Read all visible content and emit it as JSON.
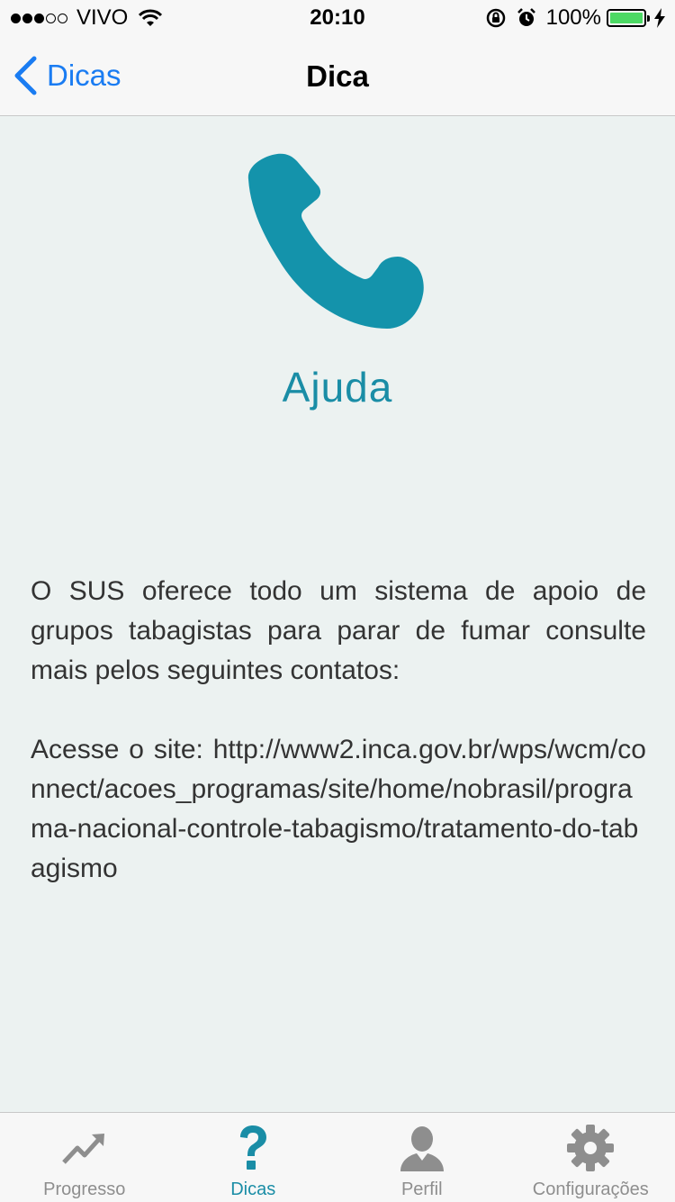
{
  "status_bar": {
    "carrier": "VIVO",
    "time": "20:10",
    "battery": "100%",
    "signal_bars_filled": 3,
    "signal_bars_total": 5,
    "icons": [
      "wifi-icon",
      "rotation-lock-icon",
      "alarm-icon",
      "battery-icon",
      "charging-icon"
    ]
  },
  "nav": {
    "back_label": "Dicas",
    "title": "Dica"
  },
  "tip": {
    "icon": "phone-icon",
    "title": "Ajuda",
    "paragraph1": "O SUS oferece todo um sistema de apoio de grupos tabagistas para parar de fumar consulte mais pelos seguintes contatos:",
    "paragraph2": "Acesse o site: http://www2.inca.gov.br/wps/wcm/connect/acoes_programas/site/home/nobrasil/programa-nacional-controle-tabagismo/tratamento-do-tabagismo"
  },
  "tabs": [
    {
      "label": "Progresso",
      "icon": "trend-chart-icon",
      "active": false
    },
    {
      "label": "Dicas",
      "icon": "question-mark-icon",
      "active": true
    },
    {
      "label": "Perfil",
      "icon": "person-icon",
      "active": false
    },
    {
      "label": "Configurações",
      "icon": "gear-icon",
      "active": false
    }
  ],
  "colors": {
    "accent": "#1a8da6",
    "ios_blue": "#1a7cf2",
    "background": "#ecf2f1",
    "inactive_tab": "#8e8e8e",
    "battery_green": "#4cd964"
  }
}
